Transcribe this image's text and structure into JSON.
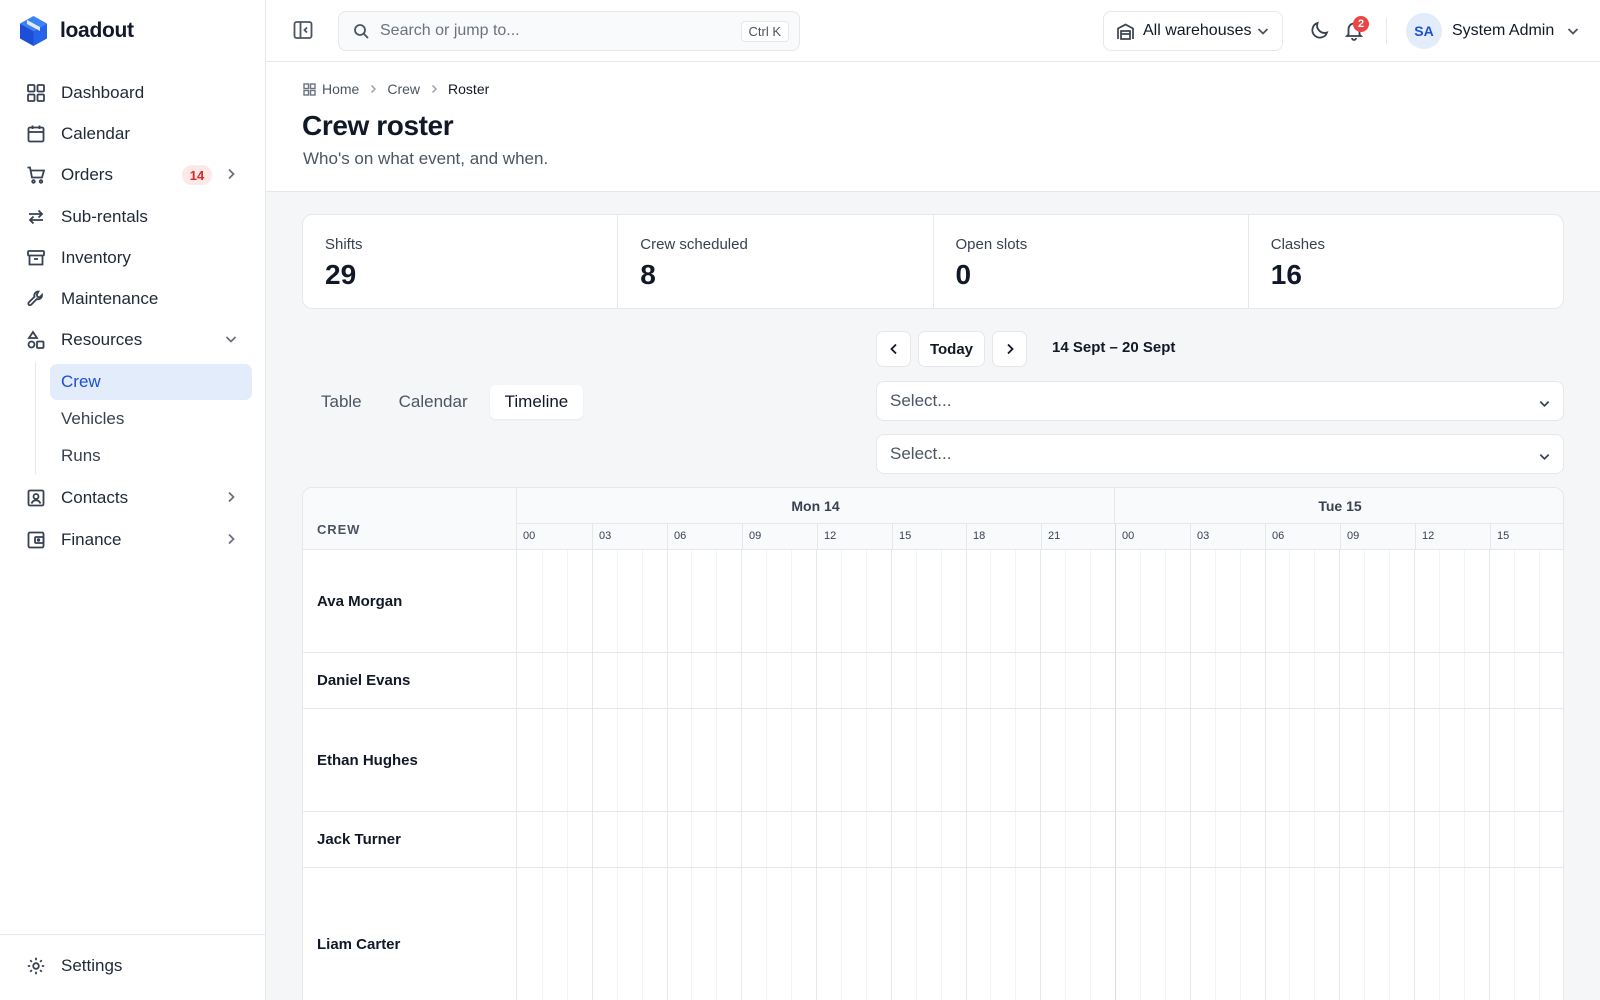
{
  "app": {
    "name": "loadout"
  },
  "sidebar": {
    "items": [
      {
        "label": "Dashboard",
        "icon": "grid-icon"
      },
      {
        "label": "Calendar",
        "icon": "calendar-icon"
      },
      {
        "label": "Orders",
        "icon": "cart-icon",
        "badge": "14"
      },
      {
        "label": "Sub-rentals",
        "icon": "arrows-icon"
      },
      {
        "label": "Inventory",
        "icon": "archive-icon"
      },
      {
        "label": "Maintenance",
        "icon": "wrench-icon"
      },
      {
        "label": "Resources",
        "icon": "shapes-icon",
        "expanded": true
      },
      {
        "label": "Contacts",
        "icon": "contact-icon"
      },
      {
        "label": "Finance",
        "icon": "wallet-icon"
      }
    ],
    "resources_children": [
      {
        "label": "Crew",
        "active": true
      },
      {
        "label": "Vehicles"
      },
      {
        "label": "Runs"
      }
    ],
    "settings_label": "Settings"
  },
  "topbar": {
    "search_placeholder": "Search or jump to...",
    "search_shortcut": "Ctrl K",
    "warehouse": "All warehouses",
    "notification_count": "2",
    "user_initials": "SA",
    "user_name": "System Admin"
  },
  "breadcrumb": [
    "Home",
    "Crew",
    "Roster"
  ],
  "page": {
    "title": "Crew roster",
    "subtitle": "Who's on what event, and when."
  },
  "stats": [
    {
      "label": "Shifts",
      "value": "29"
    },
    {
      "label": "Crew scheduled",
      "value": "8"
    },
    {
      "label": "Open slots",
      "value": "0"
    },
    {
      "label": "Clashes",
      "value": "16"
    }
  ],
  "date_nav": {
    "today_label": "Today",
    "range": "14 Sept – 20 Sept"
  },
  "view_tabs": [
    {
      "label": "Table",
      "active": false
    },
    {
      "label": "Calendar",
      "active": false
    },
    {
      "label": "Timeline",
      "active": true
    }
  ],
  "filters": [
    {
      "placeholder": "Select..."
    },
    {
      "placeholder": "Select..."
    }
  ],
  "timeline": {
    "crew_header": "CREW",
    "days": [
      "Mon 14",
      "Tue 15"
    ],
    "hours_day1": [
      "00",
      "03",
      "06",
      "09",
      "12",
      "15",
      "18",
      "21"
    ],
    "hours_day2": [
      "00",
      "03",
      "06",
      "09",
      "12",
      "15"
    ],
    "rows": [
      "Ava Morgan",
      "Daniel Evans",
      "Ethan Hughes",
      "Jack Turner",
      "Liam Carter"
    ]
  },
  "colors": {
    "accent": "#1d4ed8",
    "accent_bg": "#e3ecfb",
    "badge_red": "#dc2626",
    "notification_red": "#ef4444",
    "logo_blue": "#2563eb"
  }
}
